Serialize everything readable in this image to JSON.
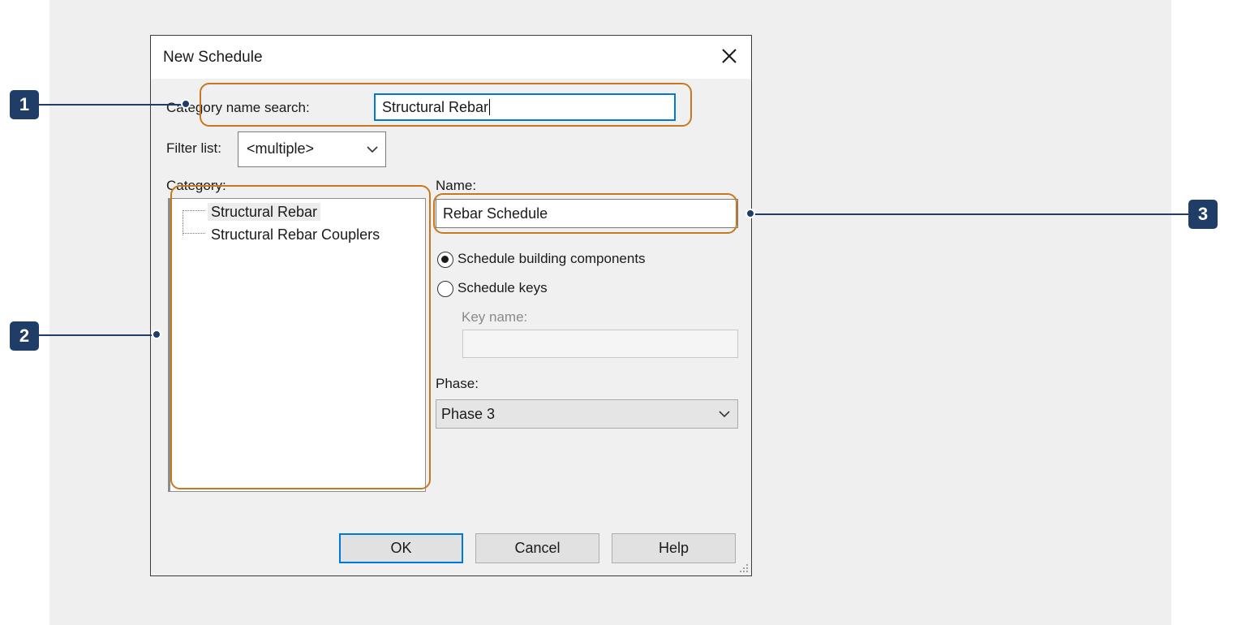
{
  "dialog": {
    "title": "New Schedule",
    "category_search_label": "Category name search:",
    "category_search_value": "Structural Rebar",
    "filter_label": "Filter list:",
    "filter_value": "<multiple>",
    "category_label": "Category:",
    "categories": [
      {
        "label": "Structural Rebar",
        "selected": true
      },
      {
        "label": "Structural Rebar Couplers",
        "selected": false
      }
    ],
    "name_label": "Name:",
    "name_value": "Rebar Schedule",
    "radio_components_label": "Schedule building components",
    "radio_keys_label": "Schedule keys",
    "key_name_label": "Key name:",
    "phase_label": "Phase:",
    "phase_value": "Phase 3",
    "ok_label": "OK",
    "cancel_label": "Cancel",
    "help_label": "Help"
  },
  "callouts": [
    "1",
    "2",
    "3"
  ],
  "colors": {
    "highlight": "#c7781e",
    "callout": "#1f3d66",
    "focus": "#0078d7"
  }
}
